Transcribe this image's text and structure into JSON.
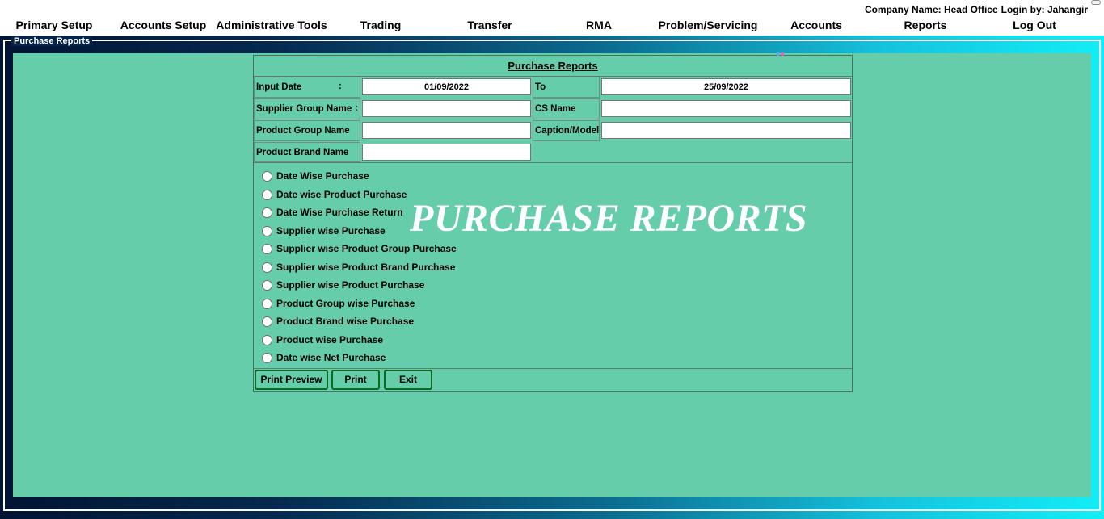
{
  "header": {
    "company_label": "Company Name: Head Office",
    "login_label": "Login by: Jahangir"
  },
  "menu": {
    "items": [
      "Primary Setup",
      "Accounts Setup",
      "Administrative Tools",
      "Trading",
      "Transfer",
      "RMA",
      "Problem/Servicing",
      "Accounts",
      "Reports",
      "Log Out"
    ]
  },
  "frame": {
    "legend": "Purchase Reports"
  },
  "form": {
    "title": "Purchase Reports",
    "input_date_label": "Input Date",
    "colon": ":",
    "input_date_value": "01/09/2022",
    "to_label": "To",
    "to_date_value": "25/09/2022",
    "supplier_group_label": "Supplier Group Name",
    "supplier_group_value": "",
    "cs_name_label": "CS Name",
    "cs_name_value": "",
    "product_group_label": "Product Group Name",
    "product_group_value": "",
    "caption_model_label": "Caption/Model",
    "caption_model_value": "",
    "product_brand_label": "Product Brand Name",
    "product_brand_value": ""
  },
  "report_options": [
    "Date Wise Purchase",
    "Date wise Product Purchase",
    "Date Wise Purchase Return",
    "Supplier wise Purchase",
    "Supplier wise Product Group Purchase",
    "Supplier wise Product Brand Purchase",
    "Supplier wise Product Purchase",
    "Product Group wise Purchase",
    "Product Brand wise Purchase",
    "Product wise Purchase",
    "Date wise Net Purchase"
  ],
  "watermark": "PURCHASE REPORTS",
  "buttons": {
    "print_preview": "Print Preview",
    "print": "Print",
    "exit": "Exit"
  },
  "colors": {
    "content_bg": "#66cdaa",
    "button_border": "#0a6a1f",
    "frame_gradient_start": "#021433",
    "frame_gradient_end": "#12eef6"
  }
}
